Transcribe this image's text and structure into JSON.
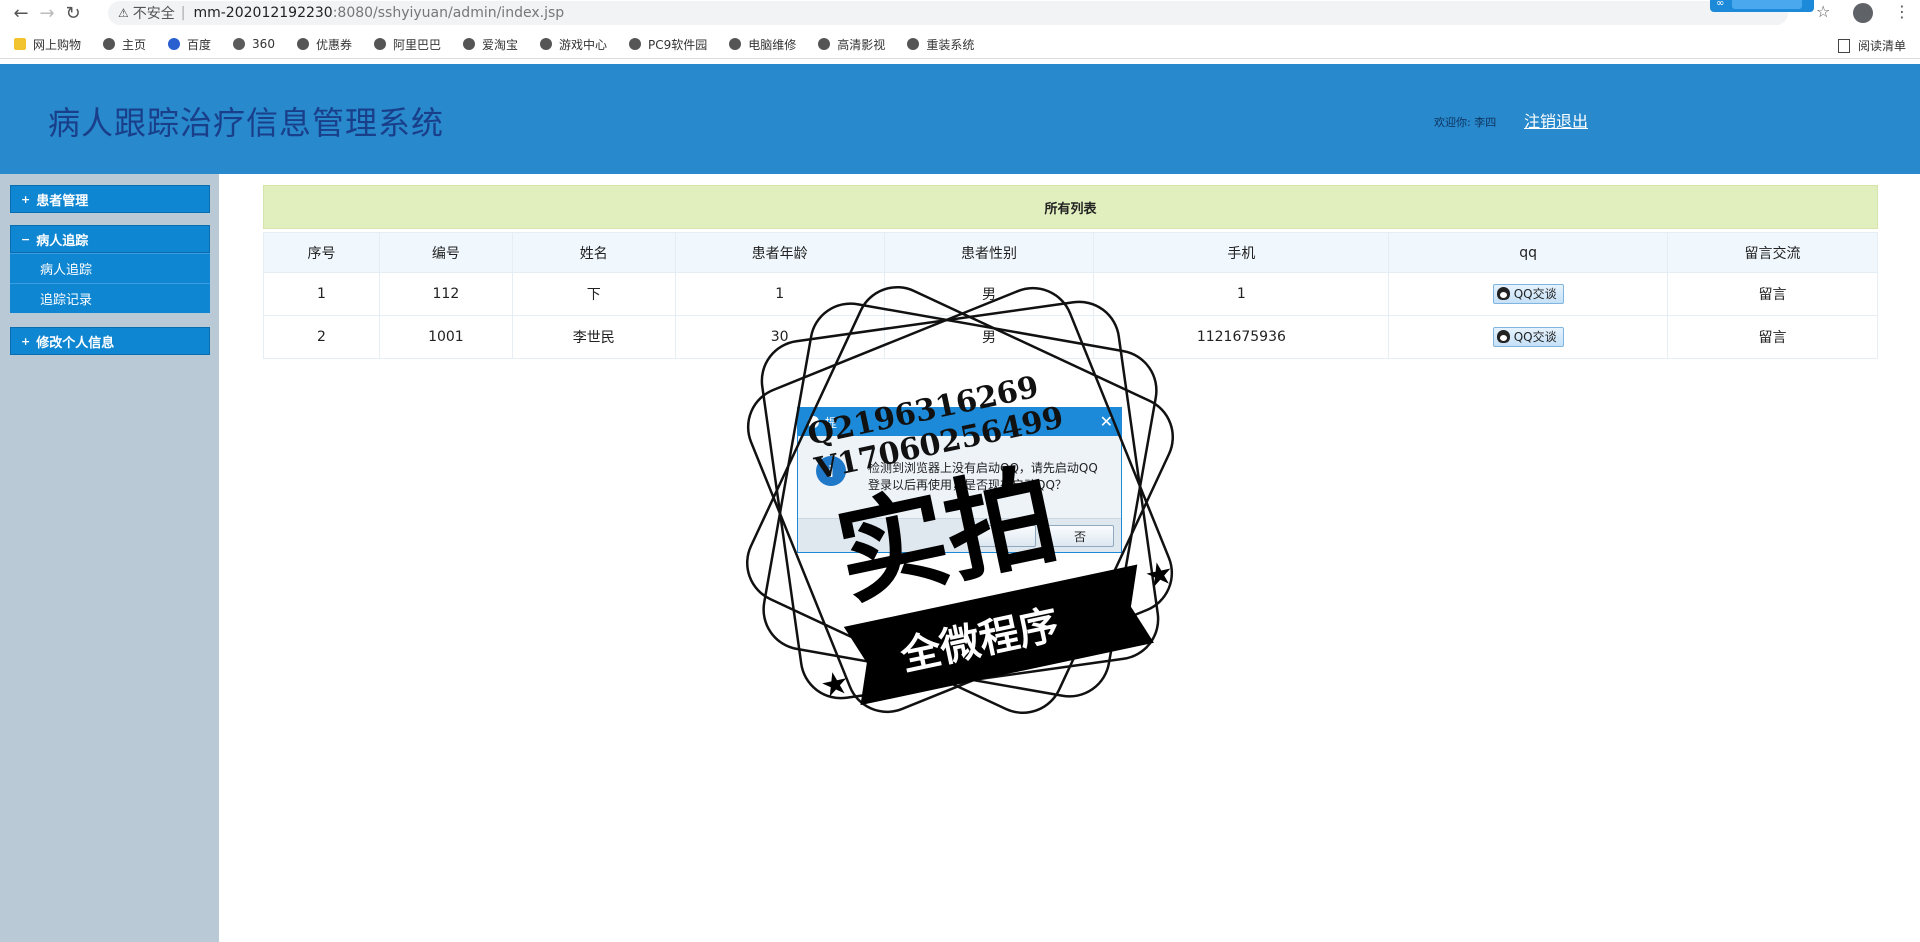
{
  "browser": {
    "insecure_label": "不安全",
    "url_host": "mm-202012192230",
    "url_path": ":8080/sshyiyuan/admin/index.jsp",
    "bookmarks": [
      "网上购物",
      "主页",
      "百度",
      "360",
      "优惠券",
      "阿里巴巴",
      "爱淘宝",
      "游戏中心",
      "PC9软件园",
      "电脑维修",
      "高清影视",
      "重装系统"
    ],
    "reading_list": "阅读清单"
  },
  "header": {
    "title": "病人跟踪治疗信息管理系统",
    "welcome": "欢迎你: 李四",
    "logout": "注销退出"
  },
  "sidebar": {
    "groups": [
      {
        "label": "患者管理",
        "symbol": "+",
        "items": []
      },
      {
        "label": "病人追踪",
        "symbol": "−",
        "items": [
          "病人追踪",
          "追踪记录"
        ]
      },
      {
        "label": "修改个人信息",
        "symbol": "+",
        "items": []
      }
    ]
  },
  "table": {
    "title": "所有列表",
    "columns": [
      "序号",
      "编号",
      "姓名",
      "患者年龄",
      "患者性别",
      "手机",
      "qq",
      "留言交流"
    ],
    "rows": [
      {
        "seq": "1",
        "code": "112",
        "name": "下",
        "age": "1",
        "gender": "男",
        "phone": "1",
        "qq": "QQ交谈",
        "msg": "留言"
      },
      {
        "seq": "2",
        "code": "1001",
        "name": "李世民",
        "age": "30",
        "gender": "男",
        "phone": "1121675936",
        "qq": "QQ交谈",
        "msg": "留言"
      }
    ]
  },
  "dialog": {
    "title": "提",
    "text": "检测到浏览器上没有启动QQ，请先启动QQ登录以后再使用，是否现在启动QQ？",
    "yes": "",
    "no": "否"
  },
  "watermark": {
    "line1": "Q2196316269",
    "line2": "V17060256499",
    "big": "实拍",
    "ribbon": "全微程序"
  },
  "colors": {
    "header_bg": "#2889cc",
    "title_color": "#1a3f8a",
    "sidebar_bg": "#b9c9d6",
    "sidebar_group": "#0f86d2",
    "table_title_bg": "#e1efbe"
  }
}
